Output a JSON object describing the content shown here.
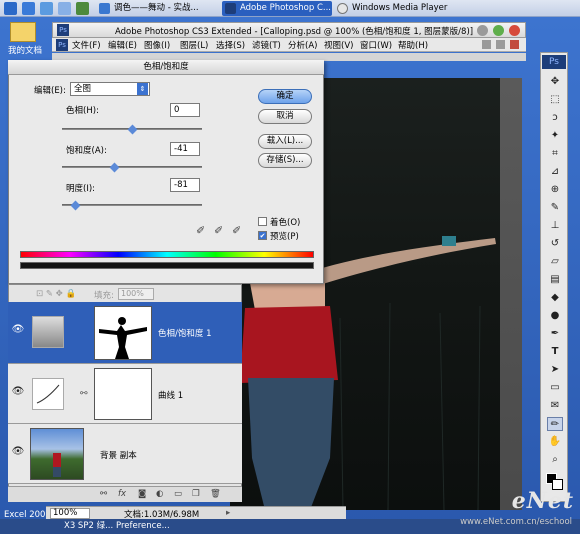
{
  "taskbar": {
    "tasks": [
      {
        "label": "调色——舞动 - 实战..."
      },
      {
        "label": "Adobe Photoshop C..."
      },
      {
        "label": "Windows Media Player"
      }
    ]
  },
  "desktop": {
    "icons": [
      {
        "label": "我的文档"
      },
      {
        "label": "Excel 200:"
      }
    ]
  },
  "ps": {
    "window_title": "Adobe Photoshop CS3 Extended - [Calloping.psd @ 100% (色相/饱和度 1, 图层蒙版/8)]",
    "badge": "Ps",
    "menus": [
      "文件(F)",
      "编辑(E)",
      "图像(I)",
      "图层(L)",
      "选择(S)",
      "滤镜(T)",
      "分析(A)",
      "视图(V)",
      "窗口(W)",
      "帮助(H)"
    ]
  },
  "dialog": {
    "title": "色相/饱和度",
    "edit_label": "编辑(E):",
    "edit_value": "全图",
    "hue_label": "色相(H):",
    "hue_value": "0",
    "sat_label": "饱和度(A):",
    "sat_value": "-41",
    "light_label": "明度(I):",
    "light_value": "-81",
    "ok": "确定",
    "cancel": "取消",
    "load": "载入(L)...",
    "save": "存储(S)...",
    "colorize": "着色(O)",
    "preview": "预览(P)",
    "colorize_checked": false,
    "preview_checked": true,
    "hue_level": 0.5,
    "sat_level": 0.37,
    "light_level": 0.09
  },
  "layers": {
    "opacity_label": "填充:",
    "opacity_value": "100%",
    "items": [
      {
        "name": "色相/饱和度 1",
        "selected": true
      },
      {
        "name": "曲线 1",
        "selected": false
      },
      {
        "name": "背景 副本",
        "selected": false
      }
    ]
  },
  "status": {
    "zoom": "100%",
    "doc": "文档:1.03M/6.98M"
  },
  "bottom": {
    "tasks": [
      "X3 SP2 绿...",
      "Preference..."
    ]
  },
  "watermark": {
    "brand": "eNet",
    "url": "www.eNet.com.cn/eschool"
  },
  "colors": {
    "accent": "#2f5fb8",
    "canvas": "#141816"
  }
}
